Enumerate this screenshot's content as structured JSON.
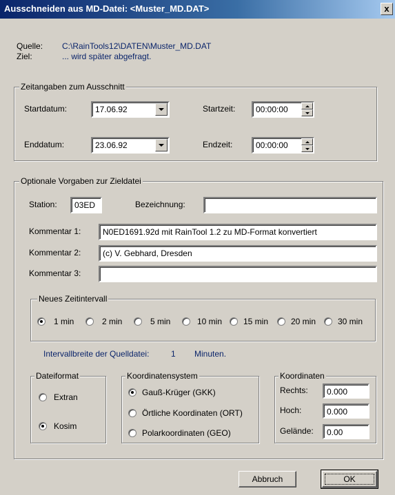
{
  "window": {
    "title": "Ausschneiden aus MD-Datei: <Muster_MD.DAT>",
    "close_glyph": "x"
  },
  "source": {
    "quelle_label": "Quelle:",
    "quelle_value": "C:\\RainTools12\\DATEN\\Muster_MD.DAT",
    "ziel_label": "Ziel:",
    "ziel_value": "... wird später abgefragt."
  },
  "time_group": {
    "legend": "Zeitangaben zum Ausschnitt",
    "startdatum_label": "Startdatum:",
    "startdatum_value": "17.06.92",
    "enddatum_label": "Enddatum:",
    "enddatum_value": "23.06.92",
    "startzeit_label": "Startzeit:",
    "startzeit_value": "00:00:00",
    "endzeit_label": "Endzeit:",
    "endzeit_value": "00:00:00"
  },
  "optional_group": {
    "legend": "Optionale Vorgaben zur Zieldatei",
    "station_label": "Station:",
    "station_value": "03ED",
    "bezeichnung_label": "Bezeichnung:",
    "bezeichnung_value": "",
    "kommentar1_label": "Kommentar 1:",
    "kommentar1_value": "N0ED1691.92d mit RainTool 1.2 zu MD-Format konvertiert",
    "kommentar2_label": "Kommentar 2:",
    "kommentar2_value": "(c) V. Gebhard, Dresden",
    "kommentar3_label": "Kommentar 3:",
    "kommentar3_value": ""
  },
  "interval_group": {
    "legend": "Neues Zeitintervall",
    "options": [
      "1 min",
      "2 min",
      "5 min",
      "10 min",
      "15 min",
      "20 min",
      "30 min"
    ],
    "selected": "1 min",
    "source_label": "Intervallbreite der Quelldatei:",
    "source_value": "1",
    "source_unit": "Minuten."
  },
  "format_group": {
    "legend": "Dateiformat",
    "options": [
      "Extran",
      "Kosim"
    ],
    "selected": "Kosim"
  },
  "coordsys_group": {
    "legend": "Koordinatensystem",
    "options": [
      "Gauß-Krüger (GKK)",
      "Örtliche Koordinaten (ORT)",
      "Polarkoordinaten (GEO)"
    ],
    "selected": "Gauß-Krüger (GKK)"
  },
  "coords_group": {
    "legend": "Koordinaten",
    "rechts_label": "Rechts:",
    "rechts_value": "0.000",
    "hoch_label": "Hoch:",
    "hoch_value": "0.000",
    "gelaende_label": "Gelände:",
    "gelaende_value": "0.00"
  },
  "buttons": {
    "cancel": "Abbruch",
    "ok": "OK"
  },
  "icons": [
    "dropdown-arrow-icon",
    "spin-up-icon",
    "spin-down-icon",
    "close-icon"
  ]
}
